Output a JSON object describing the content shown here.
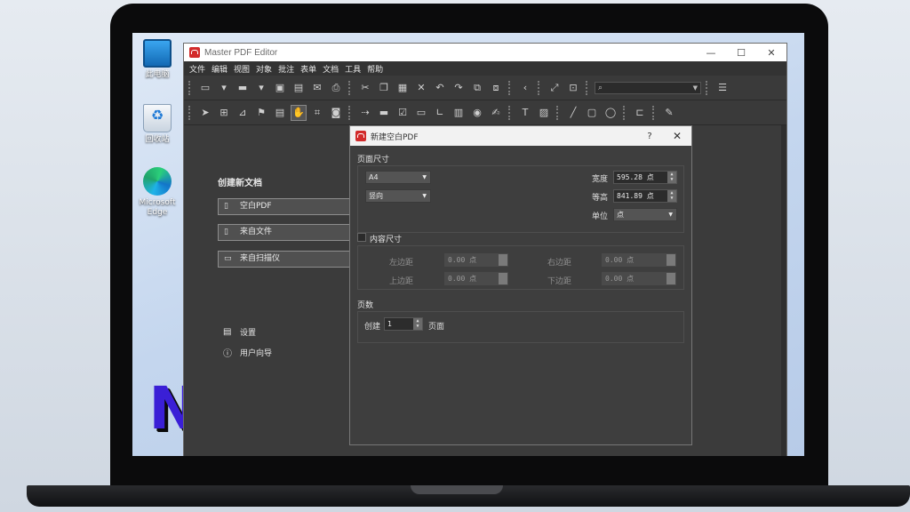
{
  "desktop": {
    "icons": [
      {
        "label": "此电脑",
        "icon": "computer-icon"
      },
      {
        "label": "回收站",
        "icon": "recycle-bin-icon"
      },
      {
        "label": "Microsoft Edge",
        "icon": "edge-icon"
      }
    ],
    "watermark_letter": "N"
  },
  "app": {
    "title": "Master PDF Editor",
    "menu": [
      "文件",
      "编辑",
      "视图",
      "对象",
      "批注",
      "表单",
      "文档",
      "工具",
      "帮助"
    ],
    "search_placeholder": "",
    "start": {
      "heading": "创建新文档",
      "buttons": [
        "空白PDF",
        "来自文件",
        "来自扫描仪"
      ],
      "links": [
        "设置",
        "用户向导"
      ]
    }
  },
  "dialog": {
    "title": "新建空白PDF",
    "help": "?",
    "close": "✕",
    "page_size": {
      "section": "页面尺寸",
      "paper": "A4",
      "orientation": "竖向",
      "width_label": "宽度",
      "width_value": "595.28 点",
      "height_label": "等高",
      "height_value": "841.89 点",
      "unit_label": "单位",
      "unit_value": "点"
    },
    "content_size": {
      "section": "内容尺寸",
      "left_label": "左边距",
      "left_value": "0.00 点",
      "right_label": "右边距",
      "right_value": "0.00 点",
      "top_label": "上边距",
      "top_value": "0.00 点",
      "bottom_label": "下边距",
      "bottom_value": "0.00 点"
    },
    "pages": {
      "section": "页数",
      "create_label": "创建",
      "count": "1",
      "suffix": "页面"
    }
  }
}
